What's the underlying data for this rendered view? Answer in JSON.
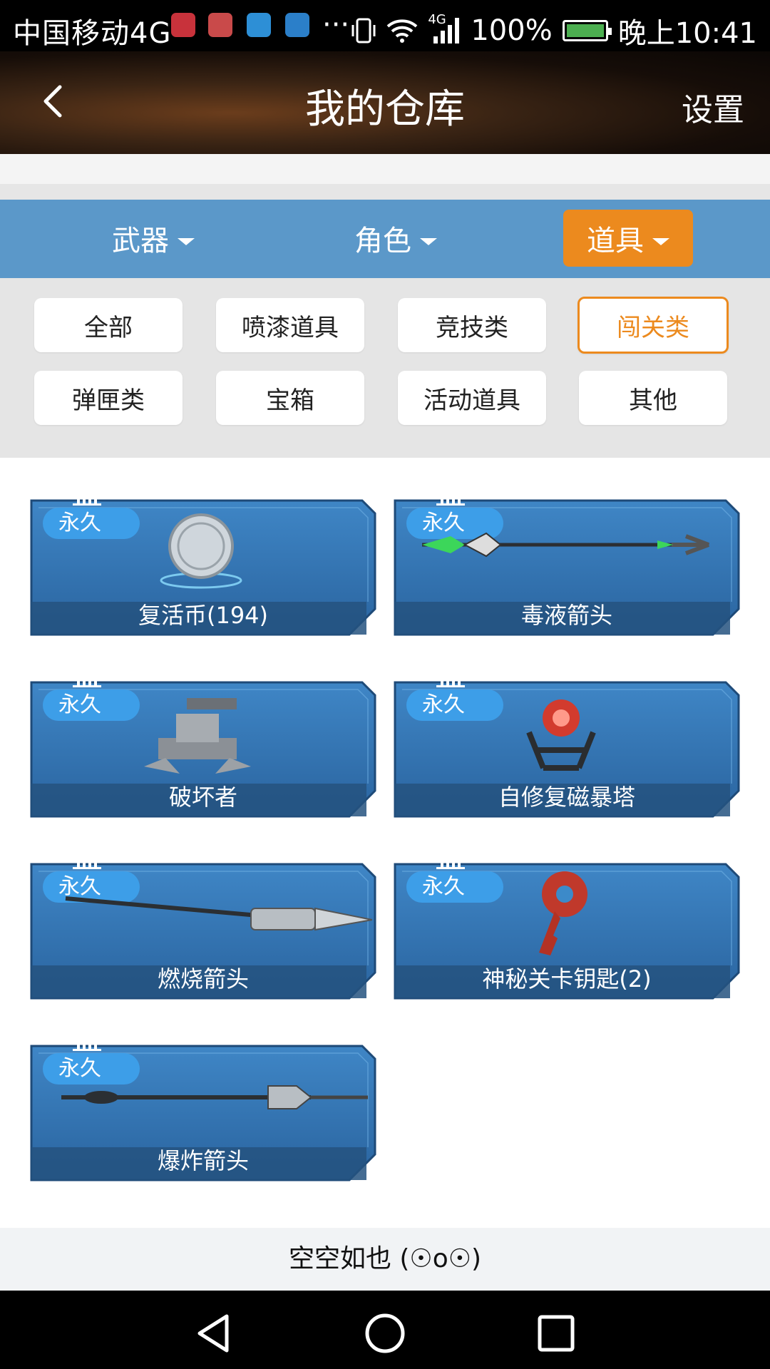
{
  "status_bar": {
    "carrier": "中国移动4G",
    "app_icons": [
      "netease-music-icon",
      "mail-icon",
      "health-icon",
      "gallery-icon"
    ],
    "more": "···",
    "network": "4G",
    "battery": "100%",
    "time": "晚上10:41"
  },
  "header": {
    "back_icon": "back-arrow-icon",
    "title": "我的仓库",
    "settings_label": "设置"
  },
  "tabs": [
    {
      "label": "武器",
      "active": false
    },
    {
      "label": "角色",
      "active": false
    },
    {
      "label": "道具",
      "active": true
    }
  ],
  "filters": [
    {
      "label": "全部",
      "selected": false
    },
    {
      "label": "喷漆道具",
      "selected": false
    },
    {
      "label": "竞技类",
      "selected": false
    },
    {
      "label": "闯关类",
      "selected": true
    },
    {
      "label": "弹匣类",
      "selected": false
    },
    {
      "label": "宝箱",
      "selected": false
    },
    {
      "label": "活动道具",
      "selected": false
    },
    {
      "label": "其他",
      "selected": false
    }
  ],
  "items": [
    {
      "badge": "永久",
      "name": "复活币(194)",
      "icon": "coin-icon"
    },
    {
      "badge": "永久",
      "name": "毒液箭头",
      "icon": "arrow-icon"
    },
    {
      "badge": "永久",
      "name": "破坏者",
      "icon": "turret-icon"
    },
    {
      "badge": "永久",
      "name": "自修复磁暴塔",
      "icon": "tesla-tower-icon"
    },
    {
      "badge": "永久",
      "name": "燃烧箭头",
      "icon": "arrow-icon"
    },
    {
      "badge": "永久",
      "name": "神秘关卡钥匙(2)",
      "icon": "key-icon"
    },
    {
      "badge": "永久",
      "name": "爆炸箭头",
      "icon": "arrow-icon"
    }
  ],
  "empty_message": "空空如也 (☉o☉)",
  "nav_bar": {
    "back": "nav-back-icon",
    "home": "nav-home-icon",
    "recent": "nav-recent-icon"
  },
  "colors": {
    "accent": "#ec8a1e",
    "tab_bar": "#5b98c9",
    "badge": "#3d9ee8",
    "card": "#2f6fae"
  }
}
